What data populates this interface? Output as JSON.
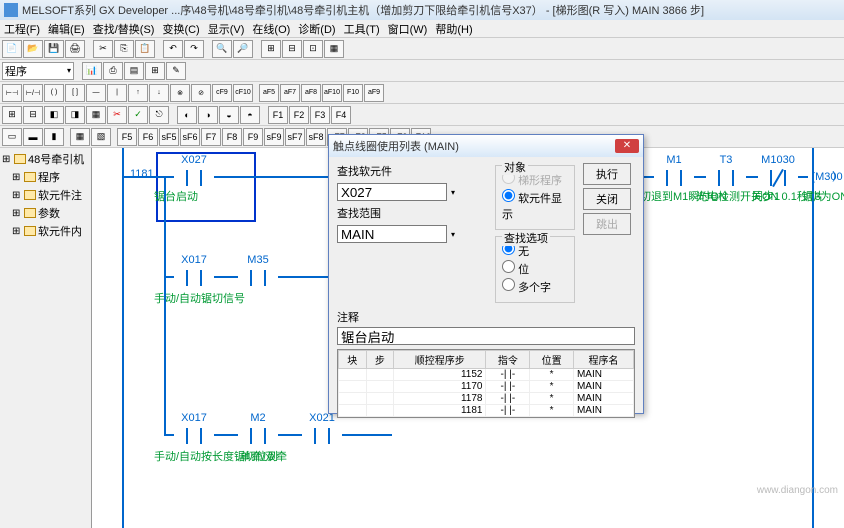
{
  "titlebar": "MELSOFT系列 GX Developer ...序\\48号机\\48号牵引机\\48号牵引机主机（增加剪刀下限给牵引机信号X37） - [梯形图(R 写入)   MAIN   3866 步]",
  "menu": {
    "m0": "工程(F)",
    "m1": "编辑(E)",
    "m2": "查找/替换(S)",
    "m3": "变换(C)",
    "m4": "显示(V)",
    "m5": "在线(O)",
    "m6": "诊断(D)",
    "m7": "工具(T)",
    "m8": "窗口(W)",
    "m9": "帮助(H)"
  },
  "toolbar2": {
    "program": "程序"
  },
  "tree": {
    "root": "48号牵引机",
    "i0": "程序",
    "i1": "软元件注",
    "i2": "参数",
    "i3": "软元件内"
  },
  "ladder": {
    "step1": "1181",
    "x027": "X027",
    "x027_txt": "锯台启动",
    "m1": "M1",
    "m1_txt": "切退到M1瞬时ON",
    "t3": "T3",
    "t3_txt": "光电检测开关ON 0.1秒T3为ON",
    "m1030": "M1030",
    "m1030_txt": "同步1",
    "coil1": "(M300",
    "coil1_txt": "锯片",
    "x017": "X017",
    "m35": "M35",
    "x017_txt": "手动/自动锯切信号",
    "x017b": "X017",
    "m2": "M2",
    "x021": "X021",
    "x017b_txt": "手动/自动按长度锯切位到",
    "m2_txt": "单牵/双牵"
  },
  "dialog": {
    "title": "触点线圈使用列表 (MAIN)",
    "lbl_find": "查找软元件",
    "find_val": "X027",
    "lbl_range": "查找范围",
    "range_val": "MAIN",
    "grp_target": "对象",
    "opt_ladder": "梯形程序",
    "opt_device": "软元件显示",
    "grp_opts": "查找选项",
    "opt_none": "无",
    "opt_bit": "位",
    "opt_multi": "多个字",
    "btn_exec": "执行",
    "btn_close": "关闭",
    "btn_out": "跳出",
    "lbl_comment": "注释",
    "comment_val": "锯台启动",
    "grid": {
      "h0": "块",
      "h1": "步",
      "h2": "顺控程序步",
      "h3": "指令",
      "h4": "位置",
      "h5": "程序名",
      "rows": [
        {
          "step": "1152",
          "inst": "-| |-",
          "pos": "*",
          "prog": "MAIN"
        },
        {
          "step": "1170",
          "inst": "-| |-",
          "pos": "*",
          "prog": "MAIN"
        },
        {
          "step": "1178",
          "inst": "-| |-",
          "pos": "*",
          "prog": "MAIN"
        },
        {
          "step": "1181",
          "inst": "-| |-",
          "pos": "*",
          "prog": "MAIN"
        }
      ]
    }
  },
  "watermark": "www.diangon.com"
}
